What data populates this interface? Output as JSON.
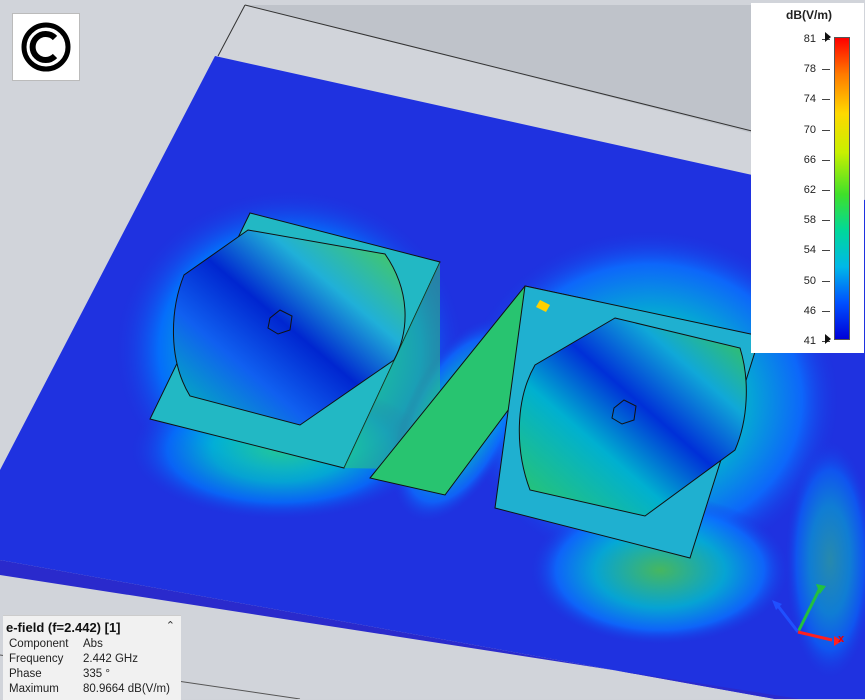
{
  "legend": {
    "unit": "dB(V/m)",
    "ticks": [
      "81",
      "78",
      "74",
      "70",
      "66",
      "62",
      "58",
      "54",
      "50",
      "46",
      "41"
    ]
  },
  "info_panel": {
    "title": "e-field (f=2.442) [1]",
    "rows": [
      {
        "label": "Component",
        "value": "Abs"
      },
      {
        "label": "Frequency",
        "value": "2.442 GHz"
      },
      {
        "label": "Phase",
        "value": "335 °"
      },
      {
        "label": "Maximum",
        "value": "80.9664 dB(V/m)"
      }
    ]
  },
  "axes": {
    "x_label": "x"
  },
  "icons": {
    "logo": "copyright-icon",
    "collapse": "chevron-up-icon"
  }
}
